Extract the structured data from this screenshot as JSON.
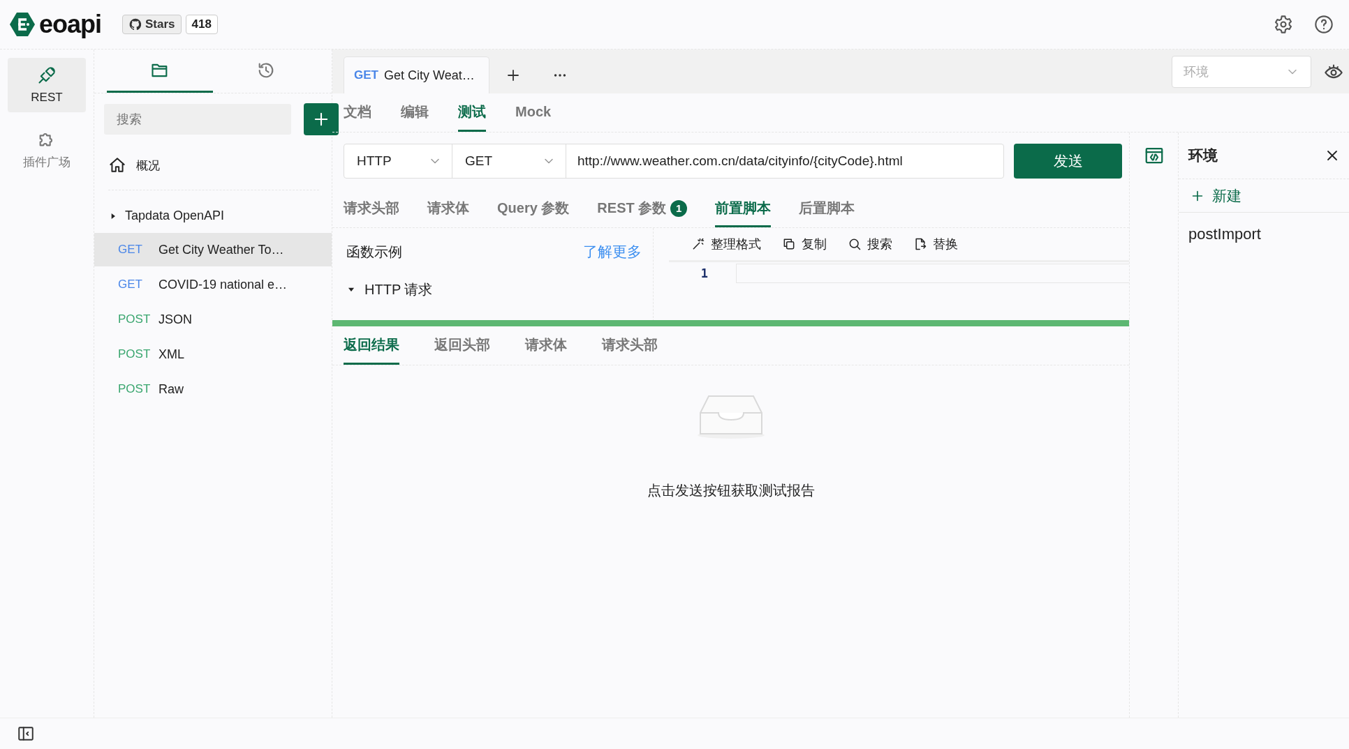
{
  "header": {
    "app_name": "eoapi",
    "stars_label": "Stars",
    "stars_count": "418"
  },
  "rail": [
    {
      "label": "REST",
      "selected": true
    },
    {
      "label": "插件广场",
      "selected": false
    }
  ],
  "sidebar": {
    "tabs": [
      {
        "selected": true
      },
      {
        "selected": false
      }
    ],
    "search": {
      "placeholder": "搜索"
    },
    "overview": "概况",
    "group": {
      "name": "Tapdata OpenAPI",
      "expanded": false
    },
    "apis": [
      {
        "method": "GET",
        "name": "Get City Weather To…",
        "selected": true
      },
      {
        "method": "GET",
        "name": "COVID-19 national e…",
        "selected": false
      },
      {
        "method": "POST",
        "name": "JSON",
        "selected": false
      },
      {
        "method": "POST",
        "name": "XML",
        "selected": false
      },
      {
        "method": "POST",
        "name": "Raw",
        "selected": false
      }
    ]
  },
  "request_tabs": [
    {
      "method": "GET",
      "title": "Get City Weat…",
      "selected": true
    }
  ],
  "environment_select": {
    "placeholder": "环境"
  },
  "view_tabs": [
    {
      "label": "文档",
      "selected": false
    },
    {
      "label": "编辑",
      "selected": false
    },
    {
      "label": "测试",
      "selected": true
    },
    {
      "label": "Mock",
      "selected": false
    }
  ],
  "request": {
    "protocol": "HTTP",
    "method": "GET",
    "url": "http://www.weather.com.cn/data/cityinfo/{cityCode}.html",
    "send": "发送"
  },
  "param_tabs": [
    {
      "label": "请求头部",
      "selected": false
    },
    {
      "label": "请求体",
      "selected": false
    },
    {
      "label": "Query 参数",
      "selected": false
    },
    {
      "label": "REST 参数",
      "badge": "1",
      "selected": false
    },
    {
      "label": "前置脚本",
      "selected": true
    },
    {
      "label": "后置脚本",
      "selected": false
    }
  ],
  "script": {
    "examples_title": "函数示例",
    "learn_more": "了解更多",
    "examples": [
      {
        "label": "HTTP 请求",
        "expanded": true
      }
    ],
    "toolbar": [
      {
        "label": "整理格式"
      },
      {
        "label": "复制"
      },
      {
        "label": "搜索"
      },
      {
        "label": "替换"
      }
    ],
    "line_numbers": [
      "1"
    ]
  },
  "response_tabs": [
    {
      "label": "返回结果",
      "selected": true
    },
    {
      "label": "返回头部",
      "selected": false
    },
    {
      "label": "请求体",
      "selected": false
    },
    {
      "label": "请求头部",
      "selected": false
    }
  ],
  "empty_message": "点击发送按钮获取测试报告",
  "environment_panel": {
    "title": "环境",
    "new_label": "新建",
    "items": [
      {
        "name": "postImport"
      }
    ]
  }
}
